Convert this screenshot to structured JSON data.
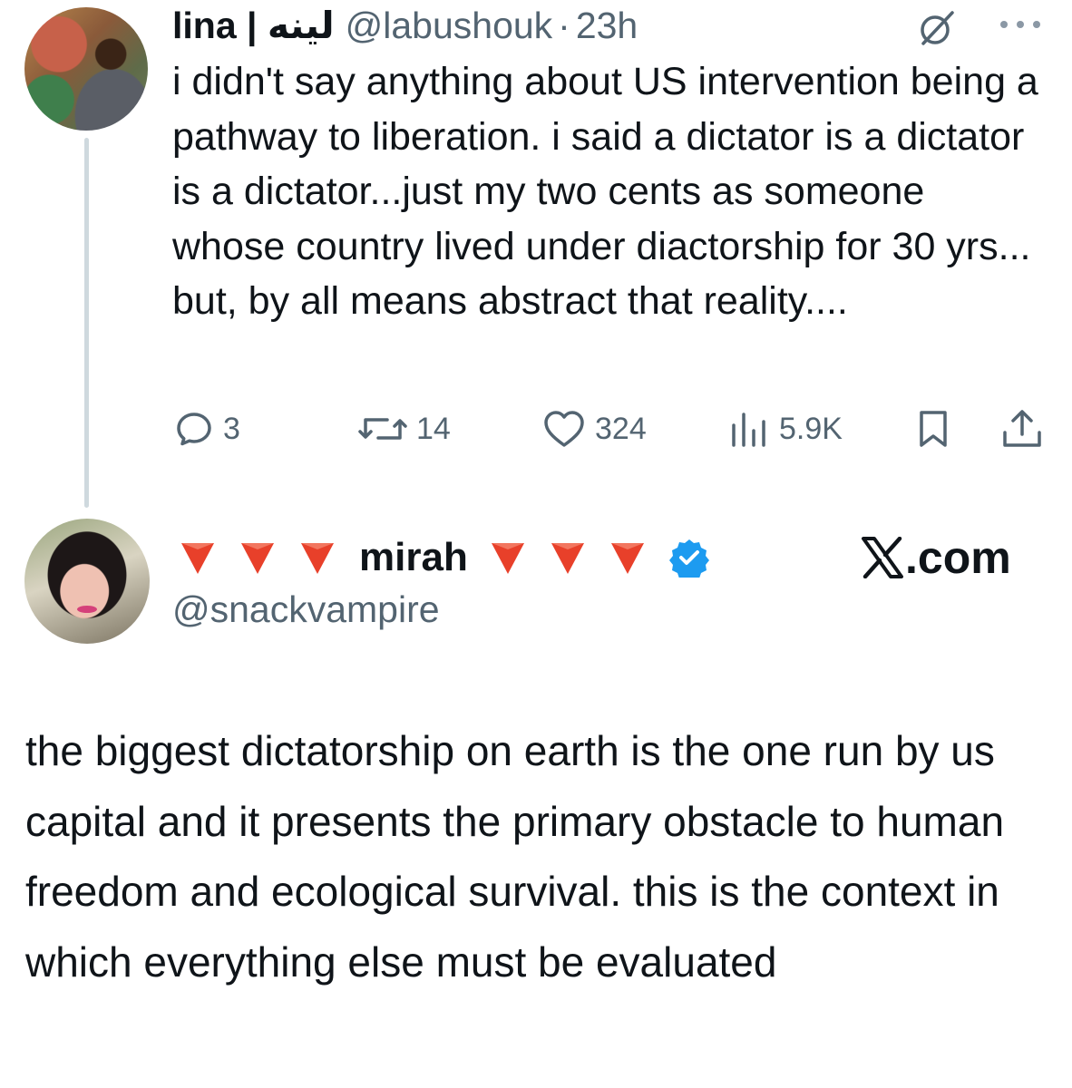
{
  "tweet": {
    "name": "lina | لينه",
    "handle": "@labushouk",
    "separator": "·",
    "time": "23h",
    "text": "i didn't say anything about US intervention being a pathway to liberation. i said a dictator is a dictator is a dictator...just my two cents as someone whose country lived under diactorship for 30 yrs... but, by all means abstract that reality....",
    "actions": {
      "replies": "3",
      "reposts": "14",
      "likes": "324",
      "views": "5.9K"
    },
    "icons": [
      "grok-icon",
      "more-icon",
      "reply-icon",
      "repost-icon",
      "like-icon",
      "views-icon",
      "bookmark-icon",
      "share-icon"
    ]
  },
  "quote": {
    "name": "mirah",
    "name_decoration": "🔻🔻🔻",
    "handle": "@snackvampire",
    "verified": true,
    "brand": ".com",
    "text": "the biggest dictatorship on earth is the one run by us capital and it presents the primary obstacle to human freedom and ecological survival. this is the context in which everything else must be evaluated"
  },
  "colors": {
    "text": "#0f1419",
    "secondary": "#536471",
    "thread_line": "#cfd9de",
    "verified": "#1d9bf0",
    "triangle": "#e8402a"
  }
}
